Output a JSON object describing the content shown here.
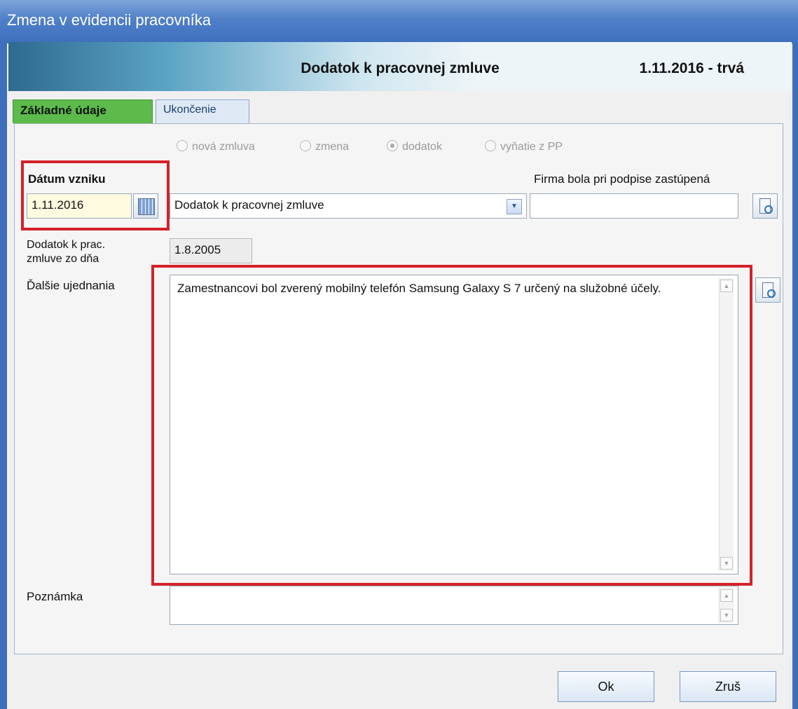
{
  "window": {
    "title": "Zmena v evidencii pracovníka"
  },
  "header": {
    "title": "Dodatok k pracovnej zmluve",
    "date_range": "1.11.2016 - trvá"
  },
  "tabs": [
    {
      "label": "Základné údaje"
    },
    {
      "label": "Ukončenie"
    }
  ],
  "radio_options": [
    {
      "label": "nová zmluva",
      "selected": false
    },
    {
      "label": "zmena",
      "selected": false
    },
    {
      "label": "dodatok",
      "selected": true
    },
    {
      "label": "vyňatie z PP",
      "selected": false
    }
  ],
  "fields": {
    "datum_vzniku_label": "Dátum vzniku",
    "datum_vzniku_value": "1.11.2016",
    "typ_value": "Dodatok k pracovnej zmluve",
    "firma_label": "Firma bola pri podpise zastúpená",
    "firma_value": "",
    "dodatok_label_line1": "Dodatok k prac.",
    "dodatok_label_line2": "zmluve zo dňa",
    "dodatok_value": "1.8.2005",
    "dalsie_label": "Ďalšie ujednania",
    "dalsie_value": "Zamestnancovi bol zverený mobilný telefón Samsung Galaxy S 7 určený na  služobné účely.",
    "poznamka_label": "Poznámka",
    "poznamka_value": ""
  },
  "buttons": {
    "ok": "Ok",
    "cancel": "Zruš"
  },
  "icons": {
    "calendar": "calendar-icon",
    "lookup": "lookup-icon",
    "dropdown": "chevron-down-icon"
  },
  "colors": {
    "highlight_red": "#d4212a",
    "active_tab": "#5cbb4a",
    "titlebar": "#4f7fc8"
  }
}
